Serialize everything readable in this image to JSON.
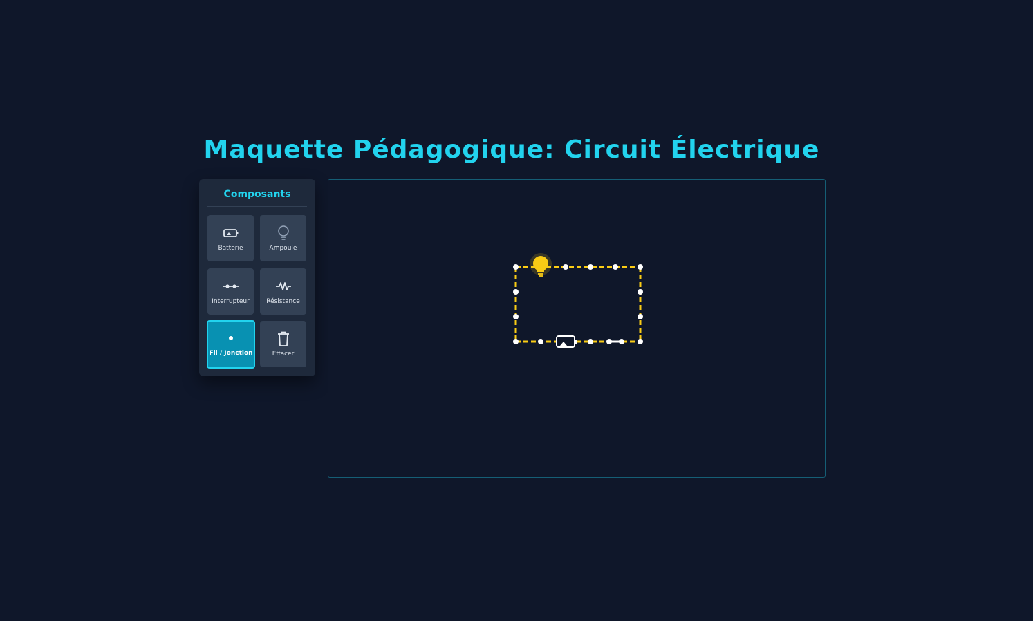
{
  "page": {
    "title": "Maquette Pédagogique: Circuit Électrique"
  },
  "toolbox": {
    "title": "Composants",
    "tools": [
      {
        "label": "Batterie",
        "icon": "battery-icon",
        "active": false
      },
      {
        "label": "Ampoule",
        "icon": "bulb-icon",
        "active": false
      },
      {
        "label": "Interrupteur",
        "icon": "switch-icon",
        "active": false
      },
      {
        "label": "Résistance",
        "icon": "resistor-icon",
        "active": false
      },
      {
        "label": "Fil / Jonction",
        "icon": "wire-dot-icon",
        "active": true
      },
      {
        "label": "Effacer",
        "icon": "trash-icon",
        "active": false
      }
    ]
  },
  "circuit": {
    "components": [
      "bulb",
      "battery",
      "switch"
    ],
    "wire_state": "dashed-yellow"
  },
  "colors": {
    "background": "#0f172a",
    "panel": "#1e293b",
    "button": "#334155",
    "accent": "#22d3ee",
    "active_button": "#0891b2",
    "wire": "#facc15",
    "bulb_on": "#facc15",
    "node": "#ffffff"
  }
}
